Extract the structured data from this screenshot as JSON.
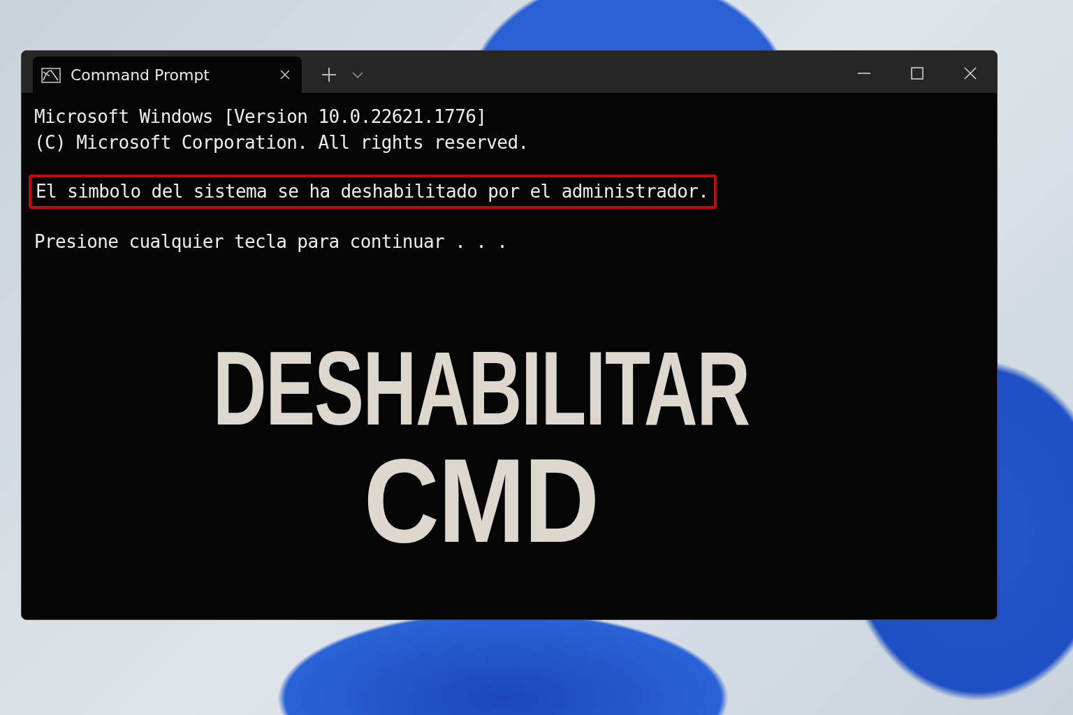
{
  "tabs": [
    {
      "title": "Command Prompt",
      "selected": true
    }
  ],
  "console_blocks": [
    {
      "highlighted": false,
      "lines": [
        "Microsoft Windows [Version 10.0.22621.1776]",
        "(C) Microsoft Corporation. All rights reserved."
      ]
    },
    {
      "highlighted": true,
      "lines": [
        "El simbolo del sistema se ha deshabilitado por el administrador."
      ]
    },
    {
      "highlighted": false,
      "lines": [
        "Presione cualquier tecla para continuar . . ."
      ]
    }
  ],
  "overlay_title": [
    "DESHABILITAR",
    "CMD"
  ]
}
